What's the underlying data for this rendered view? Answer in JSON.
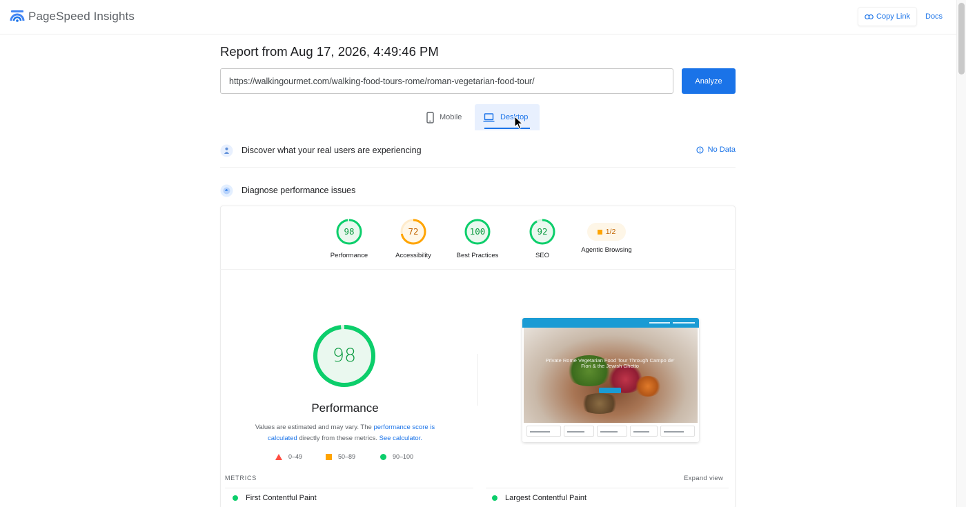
{
  "header": {
    "brand": "PageSpeed Insights",
    "copy_link": "Copy Link",
    "docs": "Docs"
  },
  "report": {
    "title": "Report from Aug 17, 2026, 4:49:46 PM",
    "url": "https://walkingourmet.com/walking-food-tours-rome/roman-vegetarian-food-tour/",
    "analyze": "Analyze"
  },
  "tabs": {
    "mobile": "Mobile",
    "desktop": "Desktop",
    "selected": "Desktop"
  },
  "field_data": {
    "title": "Discover what your real users are experiencing",
    "status": "No Data"
  },
  "diagnose": {
    "title": "Diagnose performance issues",
    "categories": [
      {
        "label": "Performance",
        "score": "98",
        "color": "#0cce6b"
      },
      {
        "label": "Accessibility",
        "score": "72",
        "color": "#ffa400"
      },
      {
        "label": "Best Practices",
        "score": "100",
        "color": "#0cce6b"
      },
      {
        "label": "SEO",
        "score": "92",
        "color": "#0cce6b"
      },
      {
        "label": "Agentic Browsing",
        "score": "1/2",
        "color": "#ffa400"
      }
    ]
  },
  "performance": {
    "score": "98",
    "label": "Performance",
    "note_prefix": "Values are estimated and may vary. The ",
    "note_link1": "performance score is calculated",
    "note_middle": " directly from these metrics. ",
    "note_link2": "See calculator."
  },
  "legend": {
    "fail": "0–49",
    "average": "50–89",
    "pass": "90–100"
  },
  "thumbnail": {
    "hero_text": "Private Rome Vegetarian Food Tour Through Campo de' Fiori & the Jewish Ghetto"
  },
  "metrics": {
    "title": "METRICS",
    "expand": "Expand view",
    "items": [
      {
        "label": "First Contentful Paint",
        "status_color": "#0cce6b"
      },
      {
        "label": "Largest Contentful Paint",
        "status_color": "#0cce6b"
      }
    ]
  },
  "colors": {
    "accent": "#1a73e8",
    "pass": "#0cce6b",
    "average": "#ffa400",
    "fail": "#ff4e42"
  }
}
